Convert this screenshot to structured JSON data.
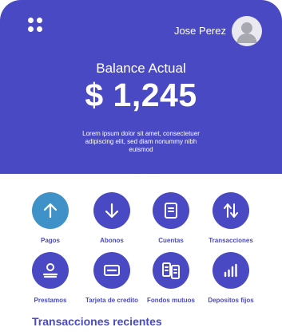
{
  "header": {
    "user_name": "Jose Perez",
    "balance_label": "Balance Actual",
    "balance_value": "$ 1,245",
    "description": "Lorem ipsum dolor sit amet, consectetuer adipiscing elit, sed diam nonummy nibh euismod"
  },
  "actions": [
    {
      "label": "Pagos",
      "icon": "arrow-up-icon",
      "active": true
    },
    {
      "label": "Abonos",
      "icon": "arrow-down-icon"
    },
    {
      "label": "Cuentas",
      "icon": "document-icon"
    },
    {
      "label": "Transacciones",
      "icon": "transfer-arrows-icon"
    },
    {
      "label": "Prestamos",
      "icon": "loan-icon"
    },
    {
      "label": "Tarjeta de credito",
      "icon": "credit-card-icon"
    },
    {
      "label": "Fondos mutuos",
      "icon": "funds-icon"
    },
    {
      "label": "Depositos fijos",
      "icon": "bar-chart-icon"
    }
  ],
  "section_title": "Transacciones recientes",
  "colors": {
    "primary": "#4949c4",
    "active": "#3f92c7",
    "background": "#ffffff"
  }
}
